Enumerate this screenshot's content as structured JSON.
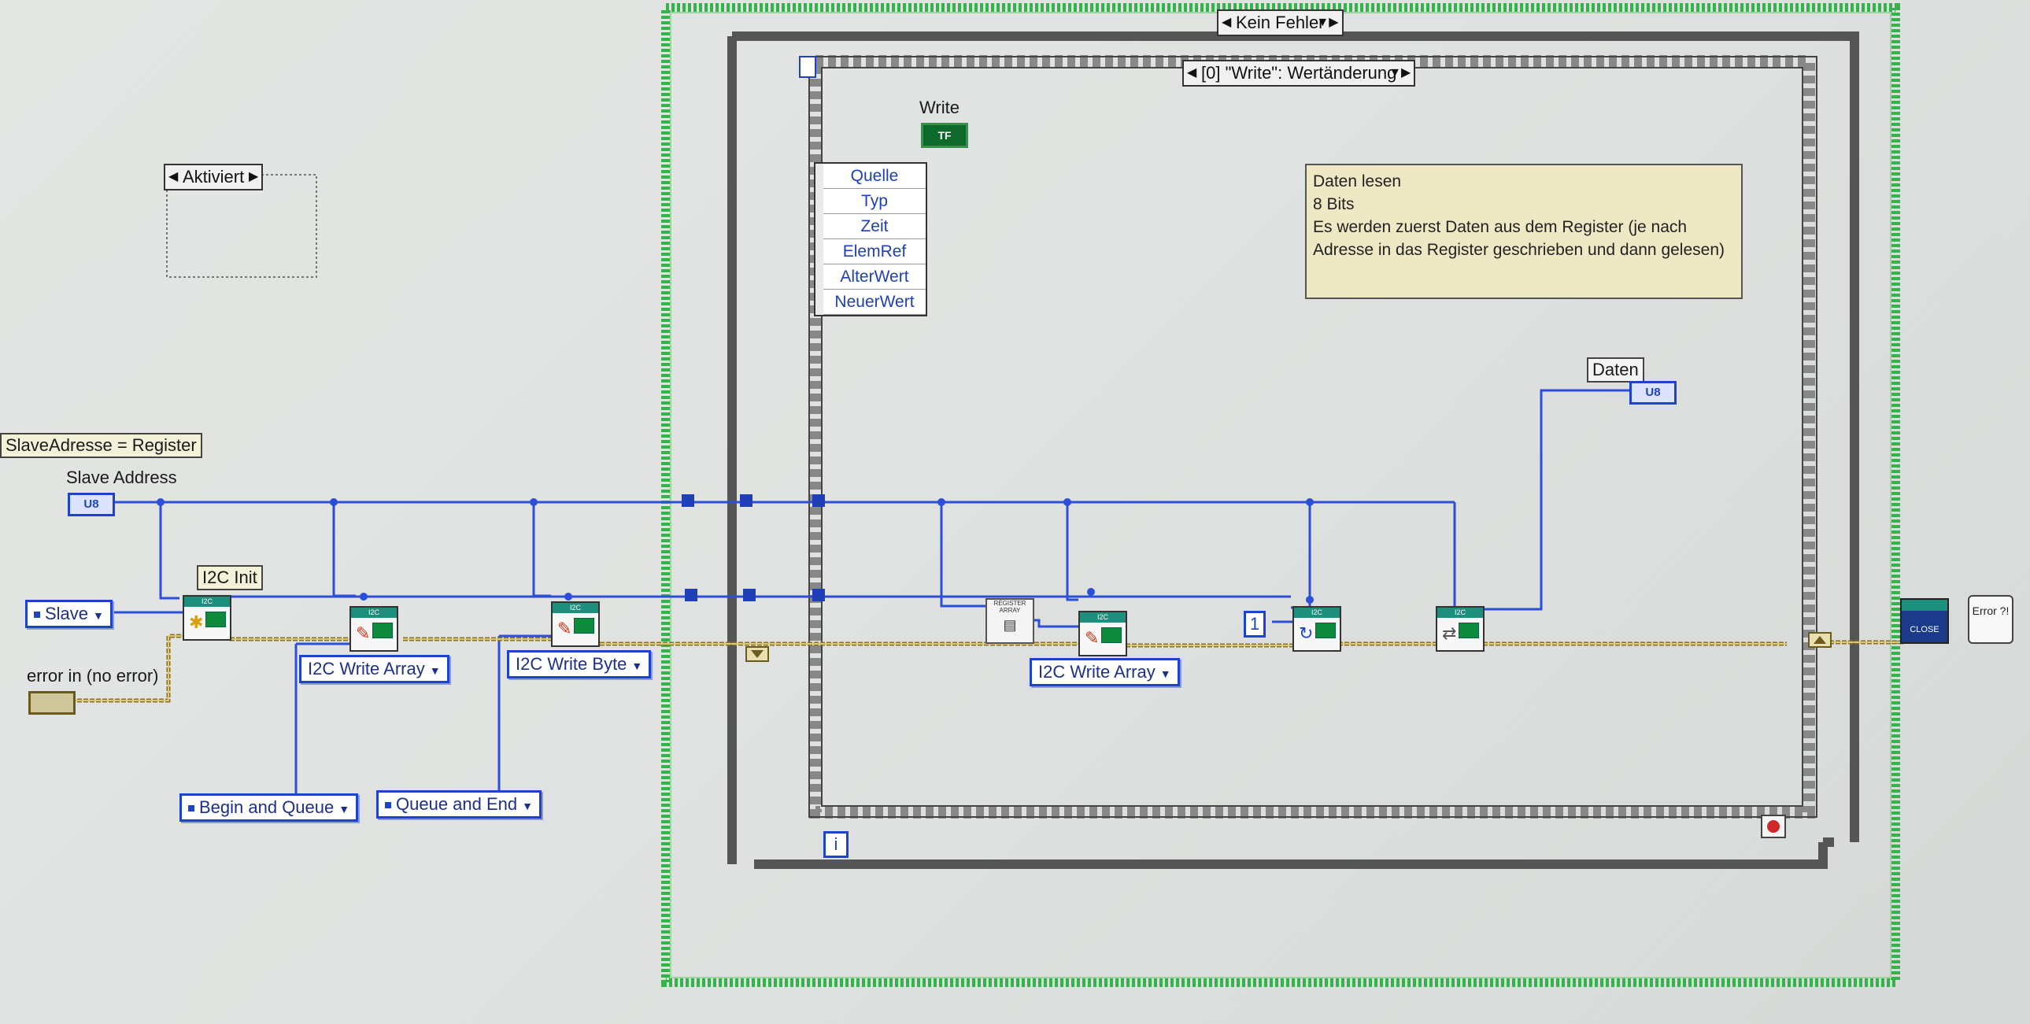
{
  "structures": {
    "outer_case": {
      "selector": "Kein Fehler"
    },
    "event_case": {
      "selector": "[0] \"Write\": Wertänderung"
    },
    "left_case": {
      "selector": "Aktiviert"
    }
  },
  "labels": {
    "slave_adresse_register": "SlaveAdresse = Register",
    "slave_address": "Slave Address",
    "i2c_init": "I2C Init",
    "error_in": "error in (no error)",
    "write": "Write",
    "daten": "Daten",
    "u8": "U8",
    "tf": "TF",
    "iteration": "i",
    "constant_one": "1"
  },
  "enums": {
    "slave": "Slave",
    "i2c_write_array_1": "I2C Write Array",
    "i2c_write_byte": "I2C Write Byte",
    "i2c_write_array_2": "I2C Write Array",
    "begin_and_queue": "Begin and Queue",
    "queue_and_end": "Queue and End"
  },
  "event_data": [
    "Quelle",
    "Typ",
    "Zeit",
    "ElemRef",
    "AlterWert",
    "NeuerWert"
  ],
  "note": {
    "lines": [
      "Daten lesen",
      "8 Bits",
      "Es werden zuerst Daten aus dem Register (je nach",
      "Adresse in das Register geschrieben und dann gelesen)"
    ]
  },
  "icons": {
    "register_array": "REGISTER ARRAY",
    "close": "CLOSE",
    "error": "Error ?!",
    "vi_header": "I2C"
  },
  "colors": {
    "wire_blue": "#2b4fd8",
    "error_wire": "#b59a3a",
    "case_green": "#34b34a",
    "while_gray": "#555555",
    "vi_teal": "#1c8f7d"
  }
}
